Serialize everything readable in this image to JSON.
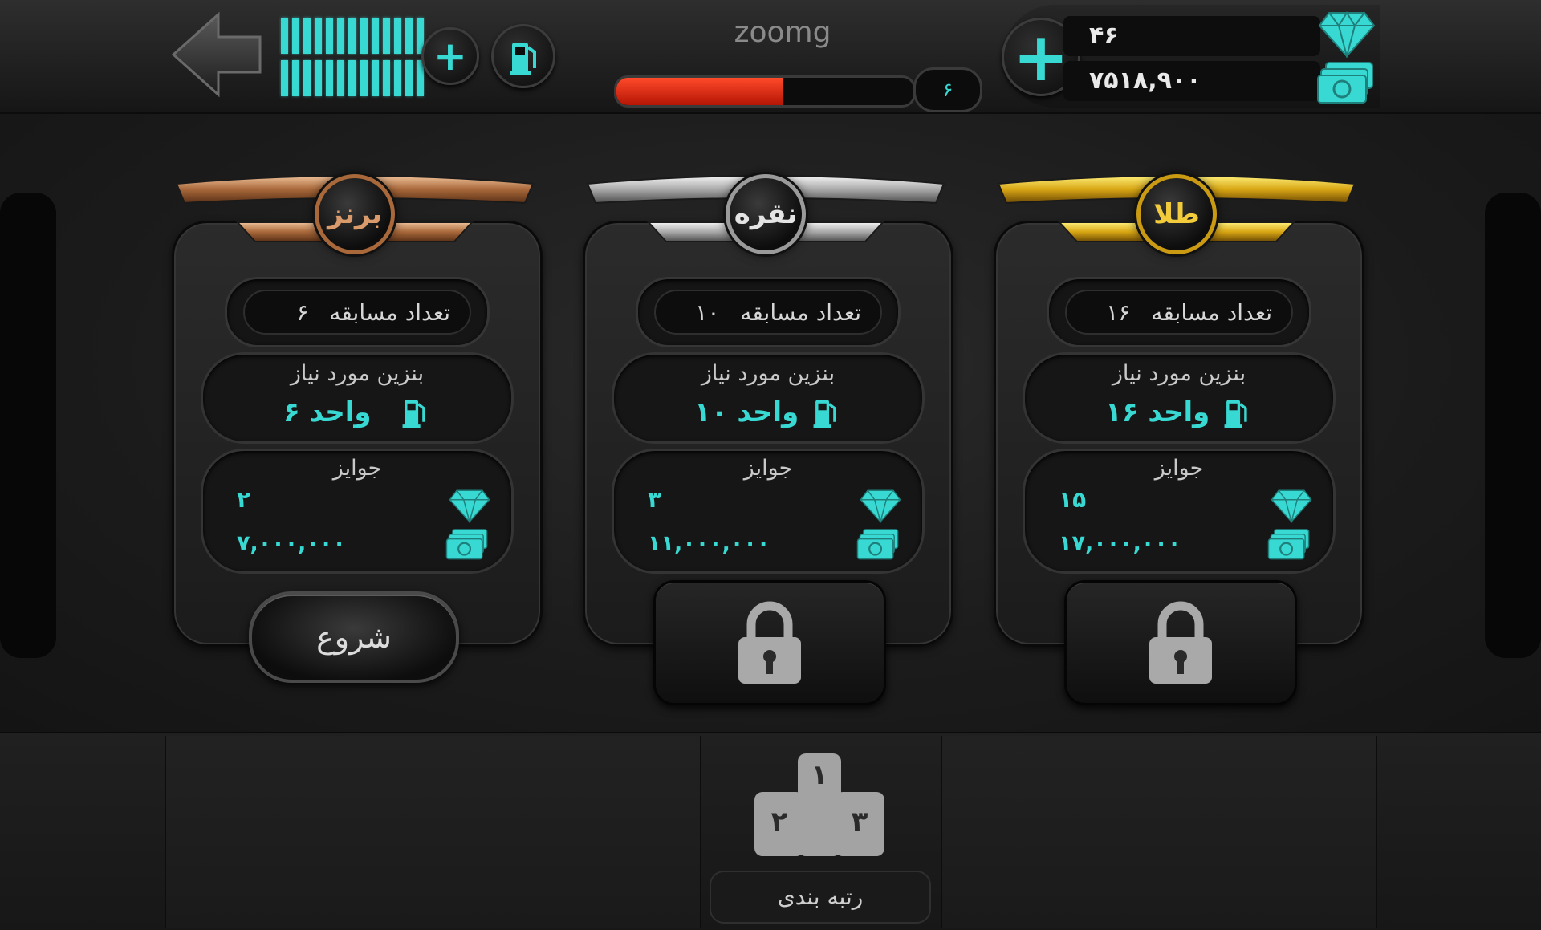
{
  "colors": {
    "accent": "#39d9d3",
    "xp_red": "#e7260e",
    "bronze": "#c78a5c",
    "silver": "#cfcfcf",
    "gold": "#e6b820",
    "lock_gray": "#a9a9a9"
  },
  "header": {
    "back_icon": "back-arrow-icon",
    "fuel_level_fraction": 1.0,
    "fuel_plus_icon": "plus-icon",
    "fuel_pump_icon": "fuel-pump-icon",
    "player_name": "zoomg",
    "xp_fraction": 0.56,
    "level": "۶",
    "diamonds": "۴۶",
    "money": "۷۵۱۸,۹۰۰",
    "add_currency_icon": "plus-icon",
    "diamond_icon": "diamond-icon",
    "cash_icon": "cash-icon"
  },
  "tiers": [
    {
      "name": "برنز",
      "races_label": "تعداد مسابقه",
      "races_value": "۶",
      "fuel_title": "بنزین مورد نیاز",
      "fuel_value": "۶ واحد",
      "prizes_title": "جوایز",
      "prize_gems": "۲",
      "prize_money": "۷,۰۰۰,۰۰۰",
      "locked": false,
      "action_label": "شروع"
    },
    {
      "name": "نقره",
      "races_label": "تعداد مسابقه",
      "races_value": "۱۰",
      "fuel_title": "بنزین مورد نیاز",
      "fuel_value": "۱۰ واحد",
      "prizes_title": "جوایز",
      "prize_gems": "۳",
      "prize_money": "۱۱,۰۰۰,۰۰۰",
      "locked": true
    },
    {
      "name": "طلا",
      "races_label": "تعداد مسابقه",
      "races_value": "۱۶",
      "fuel_title": "بنزین مورد نیاز",
      "fuel_value": "۱۶ واحد",
      "prizes_title": "جوایز",
      "prize_gems": "۱۵",
      "prize_money": "۱۷,۰۰۰,۰۰۰",
      "locked": true
    }
  ],
  "footer": {
    "podium_places": [
      "۱",
      "۲",
      "۳"
    ],
    "ranking_label": "رتبه بندی",
    "podium_icon": "podium-icon"
  }
}
